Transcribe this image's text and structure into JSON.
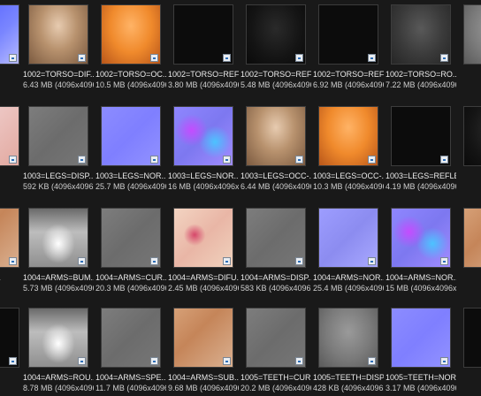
{
  "tiles": [
    {
      "id": "r1c0",
      "name": "",
      "size": "6x24)",
      "texture": "edge-blue"
    },
    {
      "id": "r1c1",
      "name": "1002=TORSO=DIF...",
      "size": "6.43 MB (4096x4096x24)",
      "texture": "diff-tan"
    },
    {
      "id": "r1c2",
      "name": "1002=TORSO=OC...",
      "size": "10.5 MB (4096x4096x24)",
      "texture": "orange"
    },
    {
      "id": "r1c3",
      "name": "1002=TORSO=REF...",
      "size": "3.80 MB (4096x4096x24)",
      "texture": "black"
    },
    {
      "id": "r1c4",
      "name": "1002=TORSO=REF...",
      "size": "5.48 MB (4096x4096x24)",
      "texture": "black2"
    },
    {
      "id": "r1c5",
      "name": "1002=TORSO=REF...",
      "size": "6.92 MB (4096x4096x24)",
      "texture": "black"
    },
    {
      "id": "r1c6",
      "name": "1002=TORSO=RO...",
      "size": "7.22 MB (4096x4096x24)",
      "texture": "darkgray"
    },
    {
      "id": "r1c7",
      "name": "1002=",
      "size": "12.5 M",
      "texture": "midgray"
    },
    {
      "id": "r2c0",
      "name": "FUS...",
      "size": "6x24)",
      "texture": "pink-edge"
    },
    {
      "id": "r2c1",
      "name": "1003=LEGS=DISP...",
      "size": "592 KB (4096x4096x24)",
      "texture": "flatgray"
    },
    {
      "id": "r2c2",
      "name": "1003=LEGS=NOR...",
      "size": "25.7 MB (4096x4096x24)",
      "texture": "normal"
    },
    {
      "id": "r2c3",
      "name": "1003=LEGS=NOR...",
      "size": "16 MB (4096x4096x24)",
      "texture": "normal-strong"
    },
    {
      "id": "r2c4",
      "name": "1003=LEGS=OCC-...",
      "size": "6.44 MB (4096x4096x24)",
      "texture": "diff-tan"
    },
    {
      "id": "r2c5",
      "name": "1003=LEGS=OCC-...",
      "size": "10.3 MB (4096x4096x24)",
      "texture": "orange"
    },
    {
      "id": "r2c6",
      "name": "1003=LEGS=REFLE...",
      "size": "4.19 MB (4096x4096x24)",
      "texture": "black"
    },
    {
      "id": "r2c7",
      "name": "1003=",
      "size": "5.59 M",
      "texture": "black2"
    },
    {
      "id": "r3c0",
      "name": "UBS...",
      "size": "6x24)",
      "texture": "brown"
    },
    {
      "id": "r3c1",
      "name": "1004=ARMS=BUM...",
      "size": "5.73 MB (4096x4096x24)",
      "texture": "silver"
    },
    {
      "id": "r3c2",
      "name": "1004=ARMS=CUR...",
      "size": "20.3 MB (4096x4096x24)",
      "texture": "flatgray"
    },
    {
      "id": "r3c3",
      "name": "1004=ARMS=DIFU...",
      "size": "2.45 MB (4096x4096x24)",
      "texture": "skinpink"
    },
    {
      "id": "r3c4",
      "name": "1004=ARMS=DISP...",
      "size": "583 KB (4096x4096x24)",
      "texture": "flatgray"
    },
    {
      "id": "r3c5",
      "name": "1004=ARMS=NOR...",
      "size": "25.4 MB (4096x4096x24)",
      "texture": "paleblue"
    },
    {
      "id": "r3c6",
      "name": "1004=ARMS=NOR...",
      "size": "15 MB (4096x4096x24)",
      "texture": "normal-strong"
    },
    {
      "id": "r3c7",
      "name": "1004=",
      "size": "6.53 M",
      "texture": "brown"
    },
    {
      "id": "r4c0",
      "name": "EFL...",
      "size": "6x24)",
      "texture": "black"
    },
    {
      "id": "r4c1",
      "name": "1004=ARMS=ROU...",
      "size": "8.78 MB (4096x4096x24)",
      "texture": "silver"
    },
    {
      "id": "r4c2",
      "name": "1004=ARMS=SPE...",
      "size": "11.7 MB (4096x4096x24)",
      "texture": "flatgray"
    },
    {
      "id": "r4c3",
      "name": "1004=ARMS=SUB...",
      "size": "9.68 MB (4096x4096x24)",
      "texture": "brown"
    },
    {
      "id": "r4c4",
      "name": "1005=TEETH=CUR...",
      "size": "20.2 MB (4096x4096x8)",
      "texture": "flatgray"
    },
    {
      "id": "r4c5",
      "name": "1005=TEETH=DISP...",
      "size": "428 KB (4096x4096x24)",
      "texture": "midgray"
    },
    {
      "id": "r4c6",
      "name": "1005=TEETH=NOR...",
      "size": "3.17 MB (4096x4096x24)",
      "texture": "normal"
    },
    {
      "id": "r4c7",
      "name": "1005=",
      "size": "4.75 M",
      "texture": "black"
    }
  ]
}
